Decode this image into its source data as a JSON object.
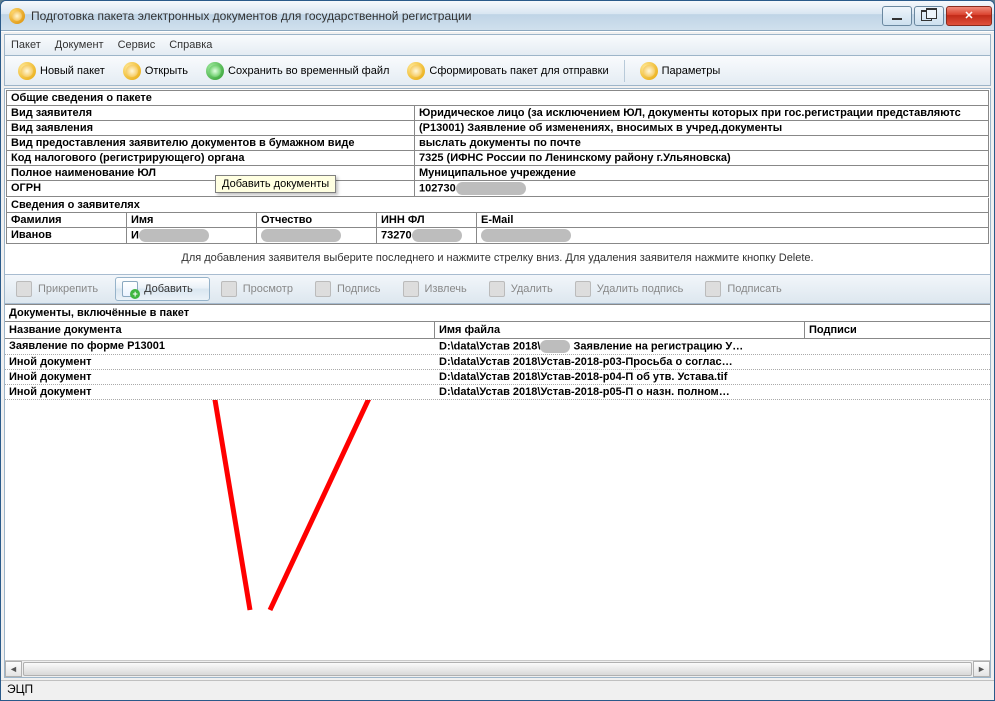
{
  "window": {
    "title": "Подготовка пакета электронных документов для государственной регистрации"
  },
  "menu": {
    "items": [
      "Пакет",
      "Документ",
      "Сервис",
      "Справка"
    ]
  },
  "toolbar": {
    "new": "Новый пакет",
    "open": "Открыть",
    "save": "Сохранить во временный файл",
    "form": "Сформировать пакет для отправки",
    "params": "Параметры"
  },
  "package_info": {
    "header": "Общие сведения о пакете",
    "rows": [
      {
        "label": "Вид заявителя",
        "value": "Юридическое лицо (за исключением ЮЛ, документы которых при гос.регистрации представляютс"
      },
      {
        "label": "Вид заявления",
        "value": "(Р13001) Заявление об изменениях, вносимых в учред.документы"
      },
      {
        "label": "Вид предоставления заявителю документов в бумажном виде",
        "value": "выслать документы по почте"
      },
      {
        "label": "Код налогового (регистрирующего) органа",
        "value": "7325 (ИФНС России по Ленинскому району г.Ульяновска)"
      },
      {
        "label": "Полное наименование ЮЛ",
        "value": "Муниципальное учреждение"
      },
      {
        "label": "ОГРН",
        "value": "102730",
        "blur_after": true
      }
    ]
  },
  "applicants": {
    "header": "Сведения о заявителях",
    "cols": [
      "Фамилия",
      "Имя",
      "Отчество",
      "ИНН ФЛ",
      "E-Mail"
    ],
    "row": {
      "fam": "Иванов",
      "name_prefix": "И",
      "inn_prefix": "73270"
    },
    "hint": "Для добавления заявителя выберите последнего и нажмите стрелку вниз. Для удаления заявителя нажмите кнопку Delete."
  },
  "toolbar2": {
    "attach": "Прикрепить",
    "add": "Добавить",
    "view": "Просмотр",
    "sig": "Подпись",
    "extract": "Извлечь",
    "delete": "Удалить",
    "delsig": "Удалить подпись",
    "sign": "Подписать",
    "tooltip": "Добавить документы"
  },
  "documents": {
    "header": "Документы, включённые в пакет",
    "cols": [
      "Название документа",
      "Имя файла",
      "Подписи"
    ],
    "rows": [
      {
        "name": "Заявление по форме Р13001",
        "file_pre": "D:\\data\\Устав 2018\\",
        "file_post": "Заявление на регистрацию У…",
        "blur_mid": true
      },
      {
        "name": "Иной документ",
        "file": "D:\\data\\Устав 2018\\Устав-2018-р03-Просьба о соглас…"
      },
      {
        "name": "Иной документ",
        "file": "D:\\data\\Устав 2018\\Устав-2018-р04-П об утв. Устава.tif"
      },
      {
        "name": "Иной документ",
        "file": "D:\\data\\Устав 2018\\Устав-2018-р05-П о назн. полном…"
      }
    ]
  },
  "status": "ЭЦП"
}
